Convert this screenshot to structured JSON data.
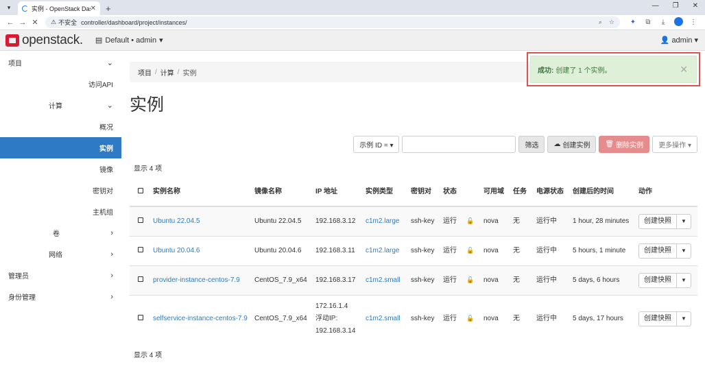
{
  "browser": {
    "tab_title": "实例 - OpenStack Dashboard",
    "security_label": "不安全",
    "url": "controller/dashboard/project/instances/"
  },
  "header": {
    "brand": "openstack.",
    "project_selector": "Default • admin",
    "user": "admin"
  },
  "sidebar": {
    "items": [
      {
        "label": "项目"
      },
      {
        "label": "访问API"
      },
      {
        "label": "计算"
      },
      {
        "label": "概况"
      },
      {
        "label": "实例"
      },
      {
        "label": "镜像"
      },
      {
        "label": "密钥对"
      },
      {
        "label": "主机组"
      },
      {
        "label": "卷"
      },
      {
        "label": "网络"
      },
      {
        "label": "管理员"
      },
      {
        "label": "身份管理"
      }
    ]
  },
  "breadcrumb": {
    "project": "项目",
    "compute": "计算",
    "current": "实例"
  },
  "page_title": "实例",
  "toolbar": {
    "filter_field": "示例 ID = ▾",
    "filter_button": "筛选",
    "create_button": "创建实例",
    "delete_button": "删除实例",
    "more_actions": "更多操作 ▾"
  },
  "count_text": "显示 4 项",
  "table": {
    "headers": {
      "name": "实例名称",
      "image": "镜像名称",
      "ip": "IP 地址",
      "flavor": "实例类型",
      "keypair": "密钥对",
      "status": "状态",
      "az": "可用域",
      "task": "任务",
      "power": "电源状态",
      "age": "创建后的时间",
      "actions": "动作"
    },
    "rows": [
      {
        "name": "Ubuntu 22.04.5",
        "image": "Ubuntu 22.04.5",
        "ip": "192.168.3.12",
        "flavor": "c1m2.large",
        "keypair": "ssh-key",
        "status": "运行",
        "az": "nova",
        "task": "无",
        "power": "运行中",
        "age": "1 hour, 28 minutes",
        "action": "创建快照"
      },
      {
        "name": "Ubuntu 20.04.6",
        "image": "Ubuntu 20.04.6",
        "ip": "192.168.3.11",
        "flavor": "c1m2.large",
        "keypair": "ssh-key",
        "status": "运行",
        "az": "nova",
        "task": "无",
        "power": "运行中",
        "age": "5 hours, 1 minute",
        "action": "创建快照"
      },
      {
        "name": "provider-instance-centos-7.9",
        "image": "CentOS_7.9_x64",
        "ip": "192.168.3.17",
        "flavor": "c1m2.small",
        "keypair": "ssh-key",
        "status": "运行",
        "az": "nova",
        "task": "无",
        "power": "运行中",
        "age": "5 days, 6 hours",
        "action": "创建快照"
      },
      {
        "name": "selfservice-instance-centos-7.9",
        "image": "CentOS_7.9_x64",
        "ip": "172.16.1.4",
        "ip_floating_label": "浮动IP:",
        "ip_floating": "192.168.3.14",
        "flavor": "c1m2.small",
        "keypair": "ssh-key",
        "status": "运行",
        "az": "nova",
        "task": "无",
        "power": "运行中",
        "age": "5 days, 17 hours",
        "action": "创建快照"
      }
    ]
  },
  "toast": {
    "title": "成功:",
    "message": "创建了 1 个实例。"
  }
}
